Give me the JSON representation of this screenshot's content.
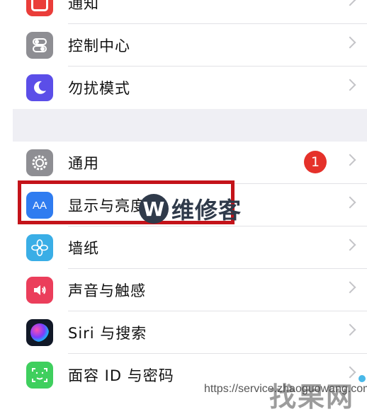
{
  "settings": {
    "rows_group1": [
      {
        "label": "通知",
        "icon": "notifications-icon",
        "color": "#ea3d3a"
      },
      {
        "label": "控制中心",
        "icon": "control-center-icon",
        "color": "#8e8e93"
      },
      {
        "label": "勿扰模式",
        "icon": "moon-icon",
        "color": "#5b4ee8"
      }
    ],
    "rows_group2": [
      {
        "label": "通用",
        "icon": "gear-icon",
        "color": "#8e8e93",
        "badge": "1"
      },
      {
        "label": "显示与亮度",
        "icon": "display-aa-icon",
        "color": "#2f7cf0"
      },
      {
        "label": "墙纸",
        "icon": "wallpaper-flower-icon",
        "color": "#3aaee6"
      },
      {
        "label": "声音与触感",
        "icon": "speaker-icon",
        "color": "#eb3e5b"
      },
      {
        "label": "Siri 与搜索",
        "icon": "siri-icon",
        "color": "#111827"
      },
      {
        "label": "面容 ID 与密码",
        "icon": "face-id-icon",
        "color": "#3fcf5e"
      }
    ]
  },
  "watermarks": {
    "logo_letter": "W",
    "logo_text": "维修客",
    "site_text": "找果网",
    "url": "https://service.zhaoguowang.com"
  }
}
